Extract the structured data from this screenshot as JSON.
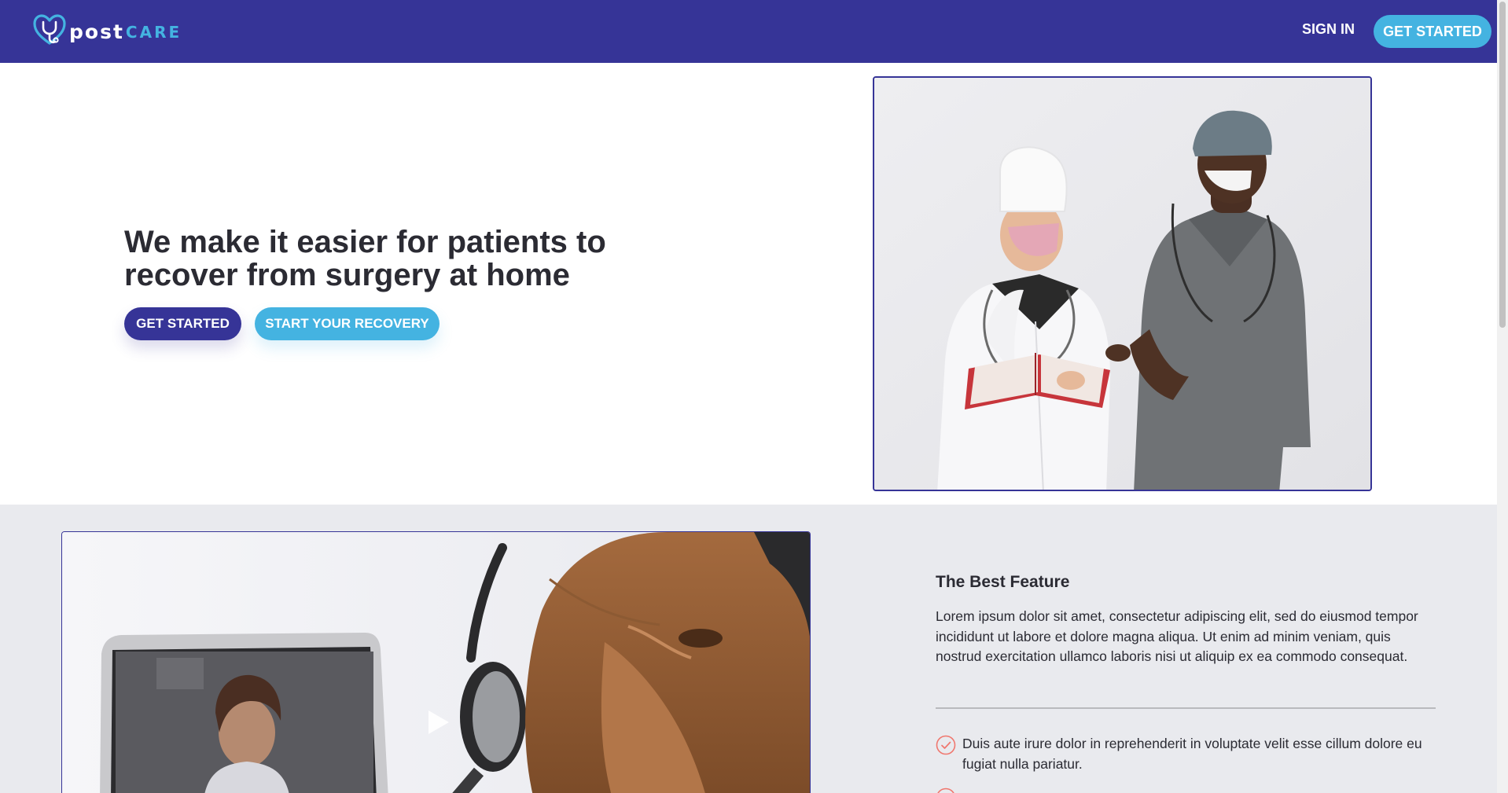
{
  "navbar": {
    "logo": {
      "word1": "post",
      "word2": "CARE",
      "icon": "stethoscope-heart-icon"
    },
    "sign_in": "SIGN IN",
    "get_started": "GET STARTED",
    "colors": {
      "background": "#363497",
      "accent": "#44b3e1"
    }
  },
  "hero": {
    "title": "We make it easier for patients to recover from surgery at home",
    "primary_button": "GET STARTED",
    "secondary_button": "START YOUR RECOVERY",
    "image": "doctors-reading-book-photo"
  },
  "feature": {
    "video": {
      "image": "patient-video-call-photo",
      "icon": "play-icon"
    },
    "title": "The Best Feature",
    "description": "Lorem ipsum dolor sit amet, consectetur adipiscing elit, sed do eiusmod tempor incididunt ut labore et dolore magna aliqua. Ut enim ad minim veniam, quis nostrud exercitation ullamco laboris nisi ut aliquip ex ea commodo consequat.",
    "items": [
      {
        "icon": "check-circle-icon",
        "text": "Duis aute irure dolor in reprehenderit in voluptate velit esse cillum dolore eu fugiat nulla pariatur."
      }
    ],
    "check_color": "#f0776e"
  }
}
